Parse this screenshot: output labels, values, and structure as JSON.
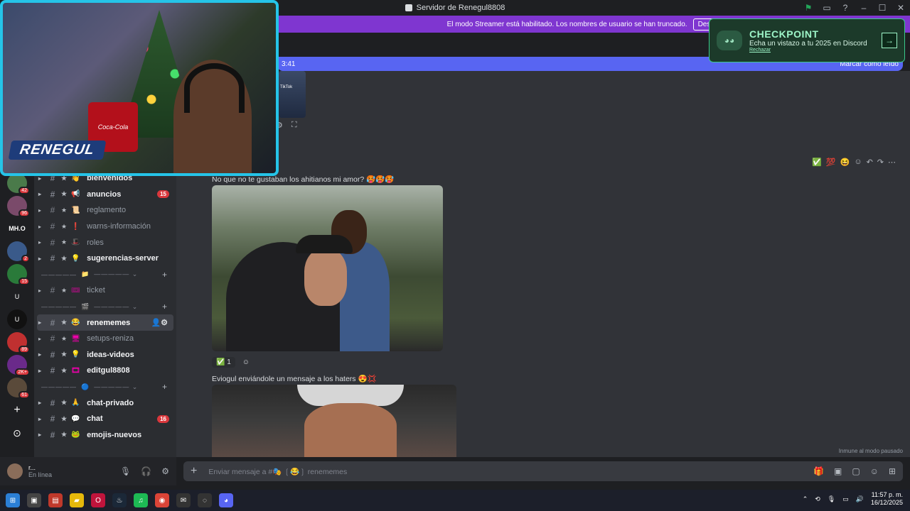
{
  "window": {
    "title": "Servidor de Renegul8808"
  },
  "streamer_bar": {
    "text": "El modo Streamer está habilitado. Los nombres de usuario se han truncado.",
    "button": "Deshabilitar"
  },
  "unread_bar": {
    "time": "3:41",
    "action": "Marcar como leído"
  },
  "checkpoint": {
    "title": "CHECKPOINT",
    "subtitle": "Echa un vistazo a tu 2025 en Discord",
    "dismiss": "Rechazar"
  },
  "webcam": {
    "name": "RENEGUL",
    "can_label": "Coca-Cola"
  },
  "tiktok_label": "TikTok",
  "servers": [
    {
      "badge": "42"
    },
    {
      "badge": "96"
    },
    {
      "label": "MH.O"
    },
    {
      "badge": "2"
    },
    {
      "badge": "15"
    },
    {
      "label": "U"
    },
    {
      "label": "U"
    },
    {
      "badge": "89"
    },
    {
      "badge": "2K+"
    },
    {
      "badge": "61"
    },
    {
      "label": "+"
    },
    {
      "label": "⊙"
    }
  ],
  "channels": [
    {
      "name": "bienvenidos",
      "type": "bold",
      "emoji": "👋"
    },
    {
      "name": "anuncios",
      "type": "bold",
      "emoji": "📢",
      "count": "15"
    },
    {
      "name": "reglamento",
      "type": "muted",
      "emoji": "📜"
    },
    {
      "name": "warns-información",
      "type": "muted",
      "emoji": "❗"
    },
    {
      "name": "roles",
      "type": "muted",
      "emoji": "🎩"
    },
    {
      "name": "sugerencias-server",
      "type": "bold",
      "emoji": "💡"
    },
    {
      "type": "sep",
      "emoji": "📁"
    },
    {
      "name": "ticket",
      "type": "muted",
      "emoji": "🎟"
    },
    {
      "type": "sep",
      "emoji": "🎬"
    },
    {
      "name": "renememes",
      "type": "selected",
      "emoji": "😂"
    },
    {
      "name": "setups-reniza",
      "type": "muted",
      "emoji": "🖥"
    },
    {
      "name": "ideas-videos",
      "type": "bold",
      "emoji": "💡"
    },
    {
      "name": "editgul8808",
      "type": "bold",
      "emoji": "🎞"
    },
    {
      "type": "sep",
      "emoji": "🔵"
    },
    {
      "name": "chat-privado",
      "type": "bold",
      "emoji": "🙏"
    },
    {
      "name": "chat",
      "type": "bold",
      "emoji": "💬",
      "count": "16"
    },
    {
      "name": "emojis-nuevos",
      "type": "bold",
      "emoji": "🐸"
    }
  ],
  "user": {
    "name": "r...",
    "status": "En línea"
  },
  "messages": [
    {
      "text": "No que no te gustaban los ahitianos mi amor? 🥵🥵🥵",
      "reaction_count": "1"
    },
    {
      "text": "Eviogul enviándole un mensaje a los haters 😍💢"
    }
  ],
  "input": {
    "placeholder": "Enviar mensaje a #🎭 ❲😂❳ renememes"
  },
  "pause_note": "Inmune al modo pausado",
  "clock": {
    "time": "11:57 p. m.",
    "date": "16/12/2025"
  }
}
